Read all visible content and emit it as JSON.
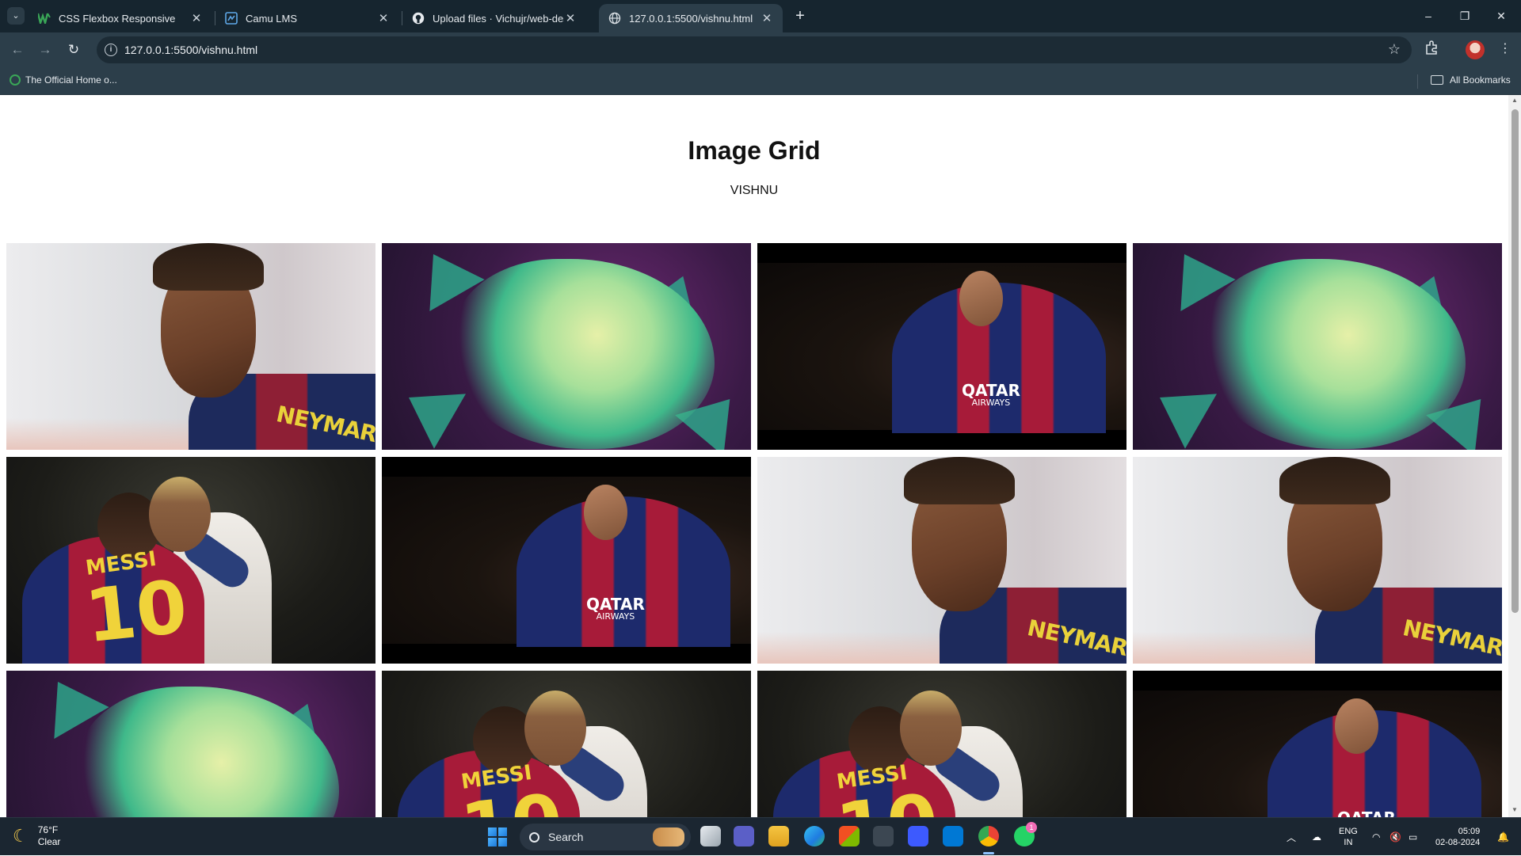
{
  "browser": {
    "tabs": [
      {
        "title": "CSS Flexbox Responsive",
        "favicon": "w3schools-icon",
        "active": false
      },
      {
        "title": "Camu LMS",
        "favicon": "camu-icon",
        "active": false
      },
      {
        "title": "Upload files · Vichujr/web-desig",
        "favicon": "github-icon",
        "active": false
      },
      {
        "title": "127.0.0.1:5500/vishnu.html",
        "favicon": "globe-icon",
        "active": true
      }
    ],
    "address": "127.0.0.1:5500/vishnu.html",
    "bookmarks": {
      "item": "The Official Home o...",
      "all": "All Bookmarks"
    }
  },
  "page": {
    "title": "Image Grid",
    "subtitle": "VISHNU",
    "images": [
      "neymar-portrait",
      "neymar-art",
      "neymar-stadium",
      "neymar-art",
      "messi-neymar-hug",
      "neymar-stadium",
      "neymar-portrait",
      "neymar-portrait",
      "neymar-art",
      "messi-neymar-hug",
      "messi-neymar-hug",
      "neymar-stadium"
    ]
  },
  "taskbar": {
    "weather_temp": "76°F",
    "weather_desc": "Clear",
    "search_label": "Search",
    "lang_1": "ENG",
    "lang_2": "IN",
    "time": "05:09",
    "date": "02-08-2024",
    "whatsapp_badge": "1"
  }
}
